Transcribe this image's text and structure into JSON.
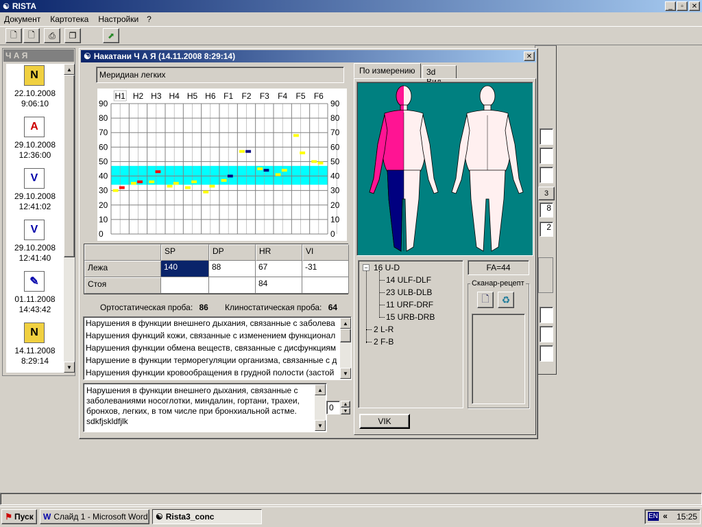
{
  "app": {
    "title": "RISTA",
    "controls": [
      "_",
      "▫",
      "✕"
    ]
  },
  "menu": [
    "Документ",
    "Картотека",
    "Настройки",
    "?"
  ],
  "left_panel": {
    "title": "Ч А Я",
    "sessions": [
      {
        "date": "22.10.2008",
        "time": "9:06:10",
        "icon": "n-folder-icon"
      },
      {
        "date": "29.10.2008",
        "time": "12:36:00",
        "icon": "pdf-icon"
      },
      {
        "date": "29.10.2008",
        "time": "12:41:02",
        "icon": "v-doc-icon"
      },
      {
        "date": "29.10.2008",
        "time": "12:41:40",
        "icon": "v-doc-icon"
      },
      {
        "date": "01.11.2008",
        "time": "14:43:42",
        "icon": "edit-doc-icon"
      },
      {
        "date": "14.11.2008",
        "time": "8:29:14",
        "icon": "n-folder-icon"
      }
    ]
  },
  "dialog": {
    "title": "Накатани Ч А Я (14.11.2008 8:29:14)",
    "meridian": "Меридиан легких",
    "chart_data": {
      "type": "scatter",
      "categories": [
        "H1",
        "H2",
        "H3",
        "H4",
        "H5",
        "H6",
        "F1",
        "F2",
        "F3",
        "F4",
        "F5",
        "F6"
      ],
      "selected_category": "H1",
      "y_ticks": [
        "90",
        "80",
        "70",
        "60",
        "50",
        "40",
        "30",
        "20",
        "10",
        "0"
      ],
      "ylim": [
        0,
        90
      ],
      "norm_band": [
        34,
        47
      ],
      "points": [
        {
          "cat": 0,
          "side": "L",
          "y": 30,
          "color": "#ffff00"
        },
        {
          "cat": 0,
          "side": "R",
          "y": 32,
          "color": "#ff0000"
        },
        {
          "cat": 1,
          "side": "L",
          "y": 35,
          "color": "#ffff00"
        },
        {
          "cat": 1,
          "side": "R",
          "y": 36,
          "color": "#ff0000"
        },
        {
          "cat": 2,
          "side": "L",
          "y": 36,
          "color": "#ffff00"
        },
        {
          "cat": 2,
          "side": "R",
          "y": 43,
          "color": "#ff0000"
        },
        {
          "cat": 3,
          "side": "L",
          "y": 33,
          "color": "#ffff00"
        },
        {
          "cat": 3,
          "side": "R",
          "y": 35,
          "color": "#ffff00"
        },
        {
          "cat": 4,
          "side": "L",
          "y": 32,
          "color": "#ffff00"
        },
        {
          "cat": 4,
          "side": "R",
          "y": 36,
          "color": "#ffff00"
        },
        {
          "cat": 5,
          "side": "L",
          "y": 29,
          "color": "#ffff00"
        },
        {
          "cat": 5,
          "side": "R",
          "y": 33,
          "color": "#ffff00"
        },
        {
          "cat": 6,
          "side": "L",
          "y": 37,
          "color": "#ffff00"
        },
        {
          "cat": 6,
          "side": "R",
          "y": 40,
          "color": "#000080"
        },
        {
          "cat": 7,
          "side": "L",
          "y": 57,
          "color": "#ffff00"
        },
        {
          "cat": 7,
          "side": "R",
          "y": 57,
          "color": "#000080"
        },
        {
          "cat": 8,
          "side": "L",
          "y": 45,
          "color": "#ffff00"
        },
        {
          "cat": 8,
          "side": "R",
          "y": 44,
          "color": "#000080"
        },
        {
          "cat": 9,
          "side": "L",
          "y": 41,
          "color": "#ffff00"
        },
        {
          "cat": 9,
          "side": "R",
          "y": 44,
          "color": "#ffff00"
        },
        {
          "cat": 10,
          "side": "L",
          "y": 68,
          "color": "#ffff00"
        },
        {
          "cat": 10,
          "side": "R",
          "y": 56,
          "color": "#ffff00"
        },
        {
          "cat": 11,
          "side": "L",
          "y": 50,
          "color": "#ffff00"
        },
        {
          "cat": 11,
          "side": "R",
          "y": 49,
          "color": "#ffff00"
        }
      ]
    },
    "table": {
      "headers": [
        "",
        "SP",
        "DP",
        "HR",
        "VI"
      ],
      "rows": [
        {
          "label": "Лежа",
          "values": [
            "140",
            "88",
            "67",
            "-31"
          ]
        },
        {
          "label": "Стоя",
          "values": [
            "",
            "",
            "84",
            ""
          ]
        }
      ]
    },
    "ortho": {
      "label": "Ортостатическая проба:",
      "value": "86"
    },
    "clino": {
      "label": "Клиностатическая проба:",
      "value": "64"
    },
    "disorders": [
      "Нарушения в функции внешнего дыхания, связанные с заболева",
      "Нарушения функций кожи, связанные с изменением функционал",
      "Нарушения функции  обмена веществ, связанные с дисфункциям",
      "Нарушение в функции терморегуляции организма, связанные с д",
      "Нарушения функции кровообращения в грудной полости (застой"
    ],
    "description": [
      "Нарушения в функции внешнего дыхания, связанные с",
      "заболеваниями носоглотки, миндалин, гортани, трахеи,",
      "бронхов, легких, в том числе при бронхиальной астме.",
      "sdkfjskldfjlk"
    ],
    "spin_value": "0",
    "tabs": [
      "По измерению",
      "3d Вид"
    ],
    "tree": [
      {
        "text": "16  U-D",
        "level": 0,
        "expander": "−"
      },
      {
        "text": "14  ULF-DLF",
        "level": 1
      },
      {
        "text": "23  ULB-DLB",
        "level": 1
      },
      {
        "text": "11  URF-DRF",
        "level": 1
      },
      {
        "text": "15  URB-DRB",
        "level": 1
      },
      {
        "text": "2   L-R",
        "level": 0
      },
      {
        "text": "2   F-B",
        "level": 0
      }
    ],
    "fa": "FA=44",
    "scenar_label": "Сканар-рецепт",
    "vik": "VIK"
  },
  "bg_window": {
    "fields": [
      "3",
      "8",
      "2"
    ]
  },
  "taskbar": {
    "start": "Пуск",
    "tasks": [
      "Слайд 1 - Microsoft Word",
      "Rista3_conc"
    ],
    "lang": "EN",
    "clock": "15:25"
  },
  "colors": {
    "teal": "#008080",
    "norm": "#00ffff",
    "pink": "#ff1493",
    "navy": "#000080"
  }
}
